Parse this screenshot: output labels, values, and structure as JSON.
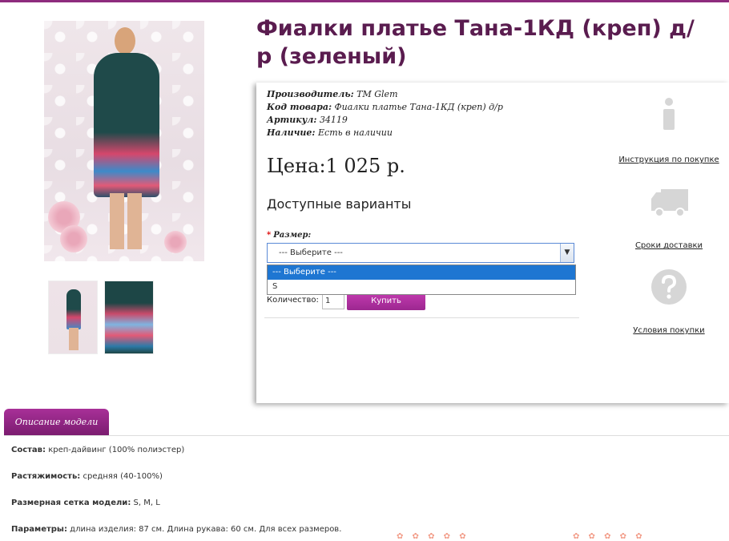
{
  "product": {
    "title": "Фиалки платье Тана-1КД (креп) д/р (зеленый)"
  },
  "meta": {
    "manufacturer_label": "Производитель:",
    "manufacturer_value": "TM Glem",
    "code_label": "Код товара:",
    "code_value": "Фиалки платье Тана-1КД (креп) д/р",
    "sku_label": "Артикул:",
    "sku_value": "34119",
    "availability_label": "Наличие:",
    "availability_value": "Есть в наличии"
  },
  "price": "Цена:1 025 р.",
  "variants_heading": "Доступные варианты",
  "size": {
    "required_mark": "*",
    "label": "Размер:",
    "selected": "--- Выберите ---",
    "arrow": "▼",
    "options": [
      "--- Выберите ---",
      "S"
    ]
  },
  "quantity": {
    "label": "Количество:",
    "value": "1"
  },
  "buy_button": "Купить",
  "sidebar_links": {
    "instructions": "Инструкция по покупке",
    "delivery": "Сроки доставки",
    "conditions": "Условия покупки"
  },
  "tabs": {
    "description": "Описание модели"
  },
  "description": {
    "composition_label": "Состав:",
    "composition_value": "креп-дайвинг (100% полиэстер)",
    "stretch_label": "Растяжимость:",
    "stretch_value": "средняя (40-100%)",
    "sizes_label": "Размерная сетка модели:",
    "sizes_value": "S, M, L",
    "params_label": "Параметры:",
    "params_value": "длина изделия: 87 см. Длина рукава: 60 см. Для всех размеров."
  },
  "colors": {
    "brand": "#8e2b7e",
    "title": "#5a1c4f",
    "button": "#b031a4",
    "icon_gray": "#d6d6d6"
  },
  "icons": [
    "info-icon",
    "truck-icon",
    "question-icon"
  ]
}
